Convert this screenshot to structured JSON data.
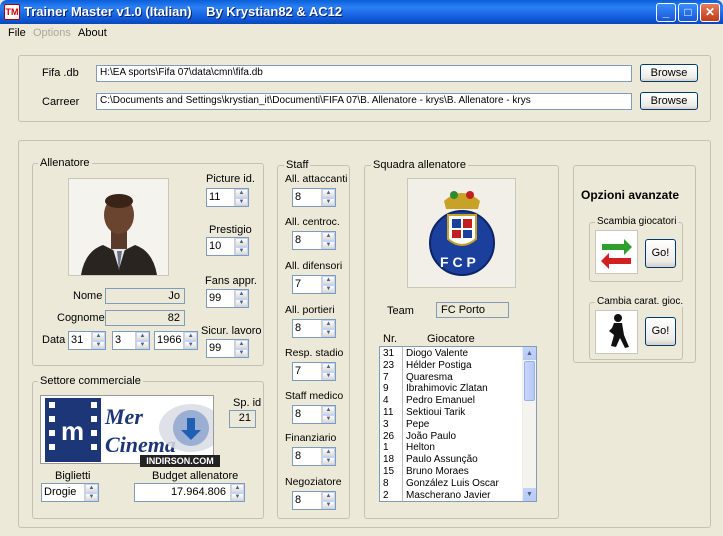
{
  "window": {
    "title": "Trainer Master v1.0 (Italian)    By Krystian82 & AC12",
    "icon_text": "TM",
    "minimize": "_",
    "maximize": "□",
    "close": "✕"
  },
  "menu": {
    "file": "File",
    "options": "Options",
    "about": "About"
  },
  "paths": {
    "fifa_label": "Fifa .db",
    "fifa_value": "H:\\EA sports\\Fifa 07\\data\\cmn\\fifa.db",
    "career_label": "Carreer",
    "career_value": "C:\\Documents and Settings\\krystian_it\\Documenti\\FIFA 07\\B. Allenatore - krys\\B. Allenatore - krys",
    "browse": "Browse"
  },
  "coach": {
    "legend": "Allenatore",
    "picture_label": "Picture id.",
    "picture_value": "11",
    "prestige_label": "Prestigio",
    "prestige_value": "10",
    "fans_label": "Fans appr.",
    "fans_value": "99",
    "security_label": "Sicur. lavoro",
    "security_value": "99",
    "name_label": "Nome",
    "name_value": "Jo",
    "surname_label": "Cognome",
    "surname_value": "82",
    "date_label": "Data",
    "day": "31",
    "month": "3",
    "year": "1966"
  },
  "commercial": {
    "legend": "Settore commerciale",
    "sponsor_label": "Sp. id",
    "sponsor_value": "21",
    "tickets_label": "Biglietti",
    "tickets_value": "Drogie",
    "budget_label": "Budget allenatore",
    "budget_value": "17.964.806",
    "logo_text": "Mer Cinema",
    "watermark": "INDIRSON.COM"
  },
  "staff": {
    "legend": "Staff",
    "items": [
      {
        "label": "All. attaccanti",
        "value": "8"
      },
      {
        "label": "All. centroc.",
        "value": "8"
      },
      {
        "label": "All. difensori",
        "value": "7"
      },
      {
        "label": "All. portieri",
        "value": "8"
      },
      {
        "label": "Resp. stadio",
        "value": "7"
      },
      {
        "label": "Staff medico",
        "value": "8"
      },
      {
        "label": "Finanziario",
        "value": "8"
      },
      {
        "label": "Negoziatore",
        "value": "8"
      }
    ]
  },
  "squad": {
    "legend": "Squadra allenatore",
    "team_label": "Team",
    "team_value": "FC Porto",
    "col_nr": "Nr.",
    "col_player": "Giocatore",
    "players": [
      {
        "nr": "31",
        "name": "Diogo Valente"
      },
      {
        "nr": "23",
        "name": "Hélder Postiga"
      },
      {
        "nr": "7",
        "name": "Quaresma"
      },
      {
        "nr": "9",
        "name": "Ibrahimovic    Zlatan"
      },
      {
        "nr": "4",
        "name": "Pedro Emanuel"
      },
      {
        "nr": "11",
        "name": "Sektioui    Tarik"
      },
      {
        "nr": "3",
        "name": "Pepe"
      },
      {
        "nr": "26",
        "name": "João Paulo"
      },
      {
        "nr": "1",
        "name": "Helton"
      },
      {
        "nr": "18",
        "name": "Paulo Assunção"
      },
      {
        "nr": "15",
        "name": "Bruno Moraes"
      },
      {
        "nr": "8",
        "name": "González    Luis Oscar"
      },
      {
        "nr": "2",
        "name": "Mascherano    Javier"
      }
    ]
  },
  "advanced": {
    "title": "Opzioni avanzate",
    "swap_legend": "Scambia giocatori",
    "change_legend": "Cambia carat. gioc.",
    "go": "Go!"
  },
  "colors": {
    "title_bar": "#0a5fd8",
    "window_bg": "#ece9d8",
    "input_border": "#7f9db9",
    "swap_green": "#2e9e2e",
    "swap_red": "#d21f1f",
    "porto_blue": "#1b3f9c"
  }
}
